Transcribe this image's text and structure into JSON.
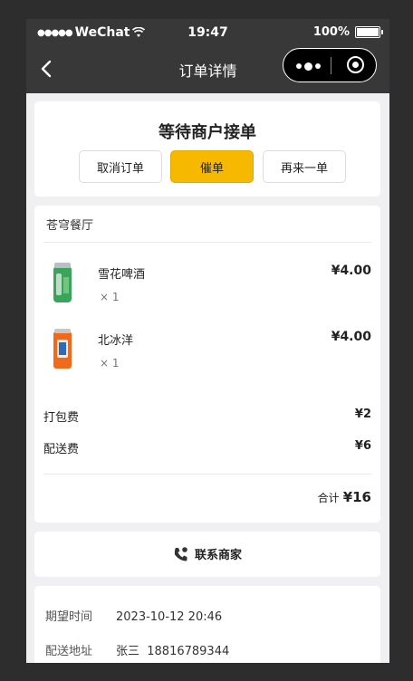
{
  "status_bar": {
    "carrier": "WeChat",
    "time": "19:47",
    "battery": "100%",
    "battery_level": 1.0
  },
  "nav": {
    "title": "订单详情"
  },
  "order_status": {
    "title": "等待商户接单",
    "buttons": {
      "cancel": "取消订单",
      "urge": "催单",
      "reorder": "再来一单"
    }
  },
  "shop": {
    "name": "苍穹餐厅"
  },
  "items": [
    {
      "name": "雪花啤酒",
      "qty": "× 1",
      "price": "¥4.00",
      "icon": "beer-can-icon"
    },
    {
      "name": "北冰洋",
      "qty": "× 1",
      "price": "¥4.00",
      "icon": "soda-can-icon"
    }
  ],
  "fees": {
    "packing_label": "打包费",
    "packing_value": "¥2",
    "delivery_label": "配送费",
    "delivery_value": "¥6"
  },
  "total": {
    "label": "合计",
    "value": "¥16"
  },
  "contact": {
    "label": "联系商家",
    "icon": "phone-icon"
  },
  "info": {
    "expected_label": "期望时间",
    "expected_value": "2023-10-12 20:46",
    "address_label": "配送地址",
    "address_value": "张三  18816789344"
  },
  "colors": {
    "accent": "#f7b800",
    "nav_bg": "#383838",
    "page_bg": "#f0f0f3"
  }
}
